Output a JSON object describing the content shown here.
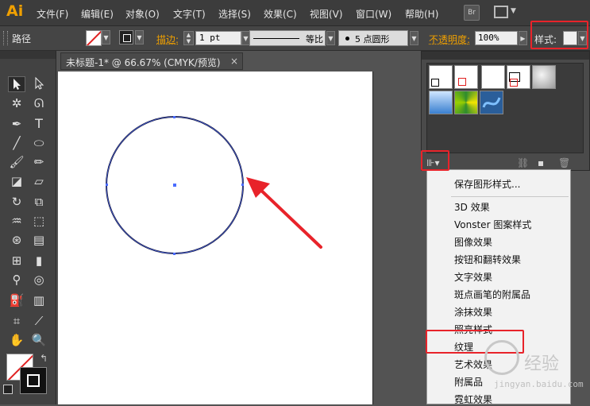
{
  "app": {
    "logo": "Ai"
  },
  "menubar": {
    "items": [
      "文件(F)",
      "编辑(E)",
      "对象(O)",
      "文字(T)",
      "选择(S)",
      "效果(C)",
      "视图(V)",
      "窗口(W)",
      "帮助(H)"
    ],
    "bridge_label": "Br"
  },
  "controlbar": {
    "selection_label": "路径",
    "stroke_label": "描边:",
    "stroke_weight": "1 pt",
    "profile_label": "等比",
    "brush_label": "5 点圆形",
    "opacity_label": "不透明度:",
    "opacity_value": "100%",
    "style_label": "样式:"
  },
  "document": {
    "tab_title": "未标题-1* @ 66.67% (CMYK/预览)",
    "close_glyph": "×"
  },
  "toolbar": {
    "type_tool_glyph": "T"
  },
  "graphic_styles_panel": {
    "library_button_glyph": "⊪▾"
  },
  "style_library_menu": {
    "items": [
      "保存图形样式...",
      "3D 效果",
      "Vonster 图案样式",
      "图像效果",
      "按钮和翻转效果",
      "文字效果",
      "斑点画笔的附属品",
      "涂抹效果",
      "照亮样式",
      "纹理",
      "艺术效果",
      "附属品",
      "霓虹效果"
    ]
  },
  "watermark": {
    "text": "经验",
    "url": "jingyan.baidu.com"
  },
  "colors": {
    "accent_orange": "#f0a000",
    "annotation_red": "#e8232a",
    "path_stroke": "#1a1a3a",
    "selection_blue": "#4a6cff"
  }
}
